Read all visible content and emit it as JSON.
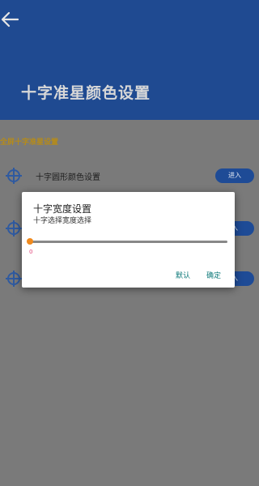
{
  "header": {
    "title": "十字准星颜色设置"
  },
  "content": {
    "section_label": "全屏十字准星设置",
    "rows": [
      {
        "label": "十字圆形颜色设置",
        "button": "进入"
      },
      {
        "label": "",
        "button": "入"
      },
      {
        "label": "",
        "button": "入"
      }
    ]
  },
  "dialog": {
    "title": "十字宽度设置",
    "subtitle": "十字选择宽度选择",
    "slider_value": "0",
    "default_button": "默认",
    "confirm_button": "确定"
  },
  "colors": {
    "header_bg": "#1f4a91",
    "button_bg": "#1e4b96",
    "section_label": "#b58b1a",
    "slider_thumb": "#f08a1e",
    "slider_value": "#e0447a",
    "dialog_button": "#0f7a7a"
  },
  "icons": {
    "back": "arrow-left-icon",
    "row_icon": "crosshair-icon"
  }
}
